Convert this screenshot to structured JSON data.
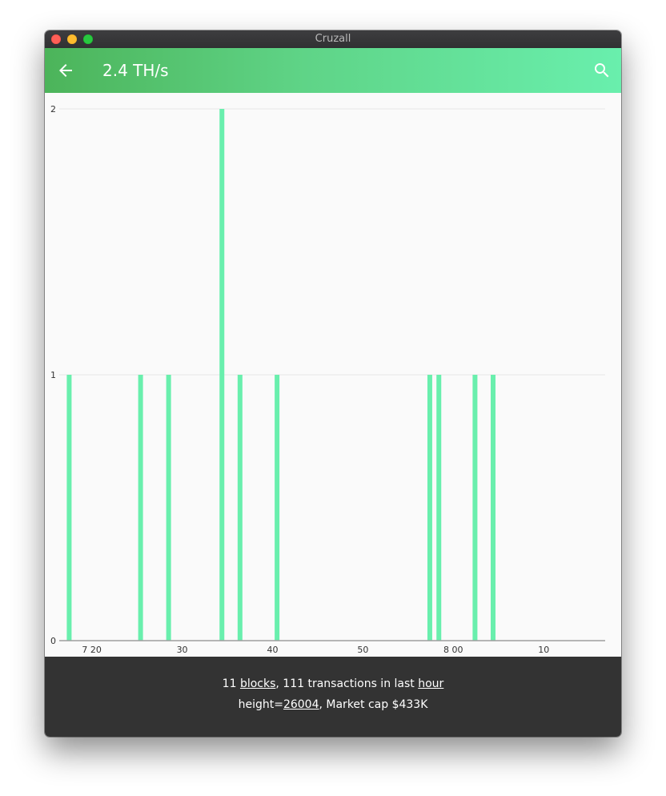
{
  "window": {
    "title": "Cruzall"
  },
  "appbar": {
    "title": "2.4 TH/s",
    "back_icon": "arrow-back-icon",
    "search_icon": "search-icon"
  },
  "colors": {
    "bar": "#69efad",
    "appbar_start": "#4cb45a",
    "appbar_end": "#69efad",
    "footer_bg": "#333333",
    "gridline": "#e6e6e6",
    "axis": "#9e9e9e"
  },
  "chart_data": {
    "type": "bar",
    "x_ticks": [
      "7 20",
      "30",
      "40",
      "50",
      "8 00",
      "10"
    ],
    "x_tick_values": [
      20,
      30,
      40,
      50,
      60,
      70
    ],
    "x_range": [
      16.4,
      76.8
    ],
    "y_ticks": [
      "0",
      "1",
      "2"
    ],
    "y_range": [
      0,
      2
    ],
    "bars": [
      {
        "x": 17.5,
        "value": 1
      },
      {
        "x": 25.4,
        "value": 1
      },
      {
        "x": 28.5,
        "value": 1
      },
      {
        "x": 34.4,
        "value": 2
      },
      {
        "x": 36.4,
        "value": 1
      },
      {
        "x": 40.5,
        "value": 1
      },
      {
        "x": 57.4,
        "value": 1
      },
      {
        "x": 58.4,
        "value": 1
      },
      {
        "x": 62.4,
        "value": 1
      },
      {
        "x": 64.4,
        "value": 1
      }
    ],
    "grid": true
  },
  "footer": {
    "line1": {
      "count": "11",
      "blocks_link": "blocks",
      "middle": ", 111 transactions in last",
      "hour_link": "hour"
    },
    "line2": {
      "height_label": "height=",
      "height_link": "26004",
      "market_cap": ", Market cap $433K"
    }
  }
}
